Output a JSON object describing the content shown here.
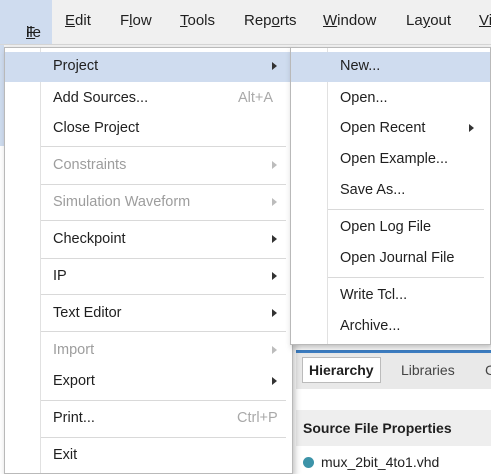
{
  "menubar": {
    "items": [
      {
        "label": "File",
        "ul": "F",
        "rest": "ile"
      },
      {
        "label": "Edit",
        "ul": "E",
        "rest": "dit"
      },
      {
        "label": "Flow",
        "pre": "F",
        "ul": "l",
        "rest": "ow"
      },
      {
        "label": "Tools",
        "ul": "T",
        "rest": "ools"
      },
      {
        "label": "Reports",
        "pre": "Rep",
        "ul": "o",
        "rest": "rts"
      },
      {
        "label": "Window",
        "ul": "W",
        "rest": "indow"
      },
      {
        "label": "Layout",
        "pre": "La",
        "ul": "y",
        "rest": "out"
      },
      {
        "label": "Vi"
      }
    ]
  },
  "file_menu": {
    "items": [
      {
        "label": "Project",
        "submenu": true,
        "highlighted": true
      },
      {
        "label": "Add Sources...",
        "accel": "Alt+A"
      },
      {
        "label": "Close Project"
      },
      {
        "label": "Constraints",
        "submenu": true,
        "disabled": true
      },
      {
        "label": "Simulation Waveform",
        "submenu": true,
        "disabled": true
      },
      {
        "label": "Checkpoint",
        "submenu": true
      },
      {
        "label": "IP",
        "submenu": true
      },
      {
        "label": "Text Editor",
        "submenu": true
      },
      {
        "label": "Import",
        "submenu": true,
        "disabled": true
      },
      {
        "label": "Export",
        "submenu": true
      },
      {
        "label": "Print...",
        "accel": "Ctrl+P"
      },
      {
        "label": "Exit"
      }
    ]
  },
  "project_menu": {
    "items": [
      {
        "label": "New...",
        "highlighted": true
      },
      {
        "label": "Open..."
      },
      {
        "label": "Open Recent",
        "submenu": true
      },
      {
        "label": "Open Example..."
      },
      {
        "label": "Save As..."
      },
      {
        "label": "Open Log File"
      },
      {
        "label": "Open Journal File"
      },
      {
        "label": "Write Tcl..."
      },
      {
        "label": "Archive..."
      }
    ]
  },
  "background": {
    "tabs": [
      "Hierarchy",
      "Libraries",
      "C"
    ],
    "source_file_properties_title": "Source File Properties",
    "file_name": "mux_2bit_4to1.vhd"
  },
  "colors": {
    "highlight": "#cfdcef",
    "accent_blue": "#3d7fc4",
    "file_dot": "#3c93a8",
    "disabled_text": "#9d9d9d"
  }
}
